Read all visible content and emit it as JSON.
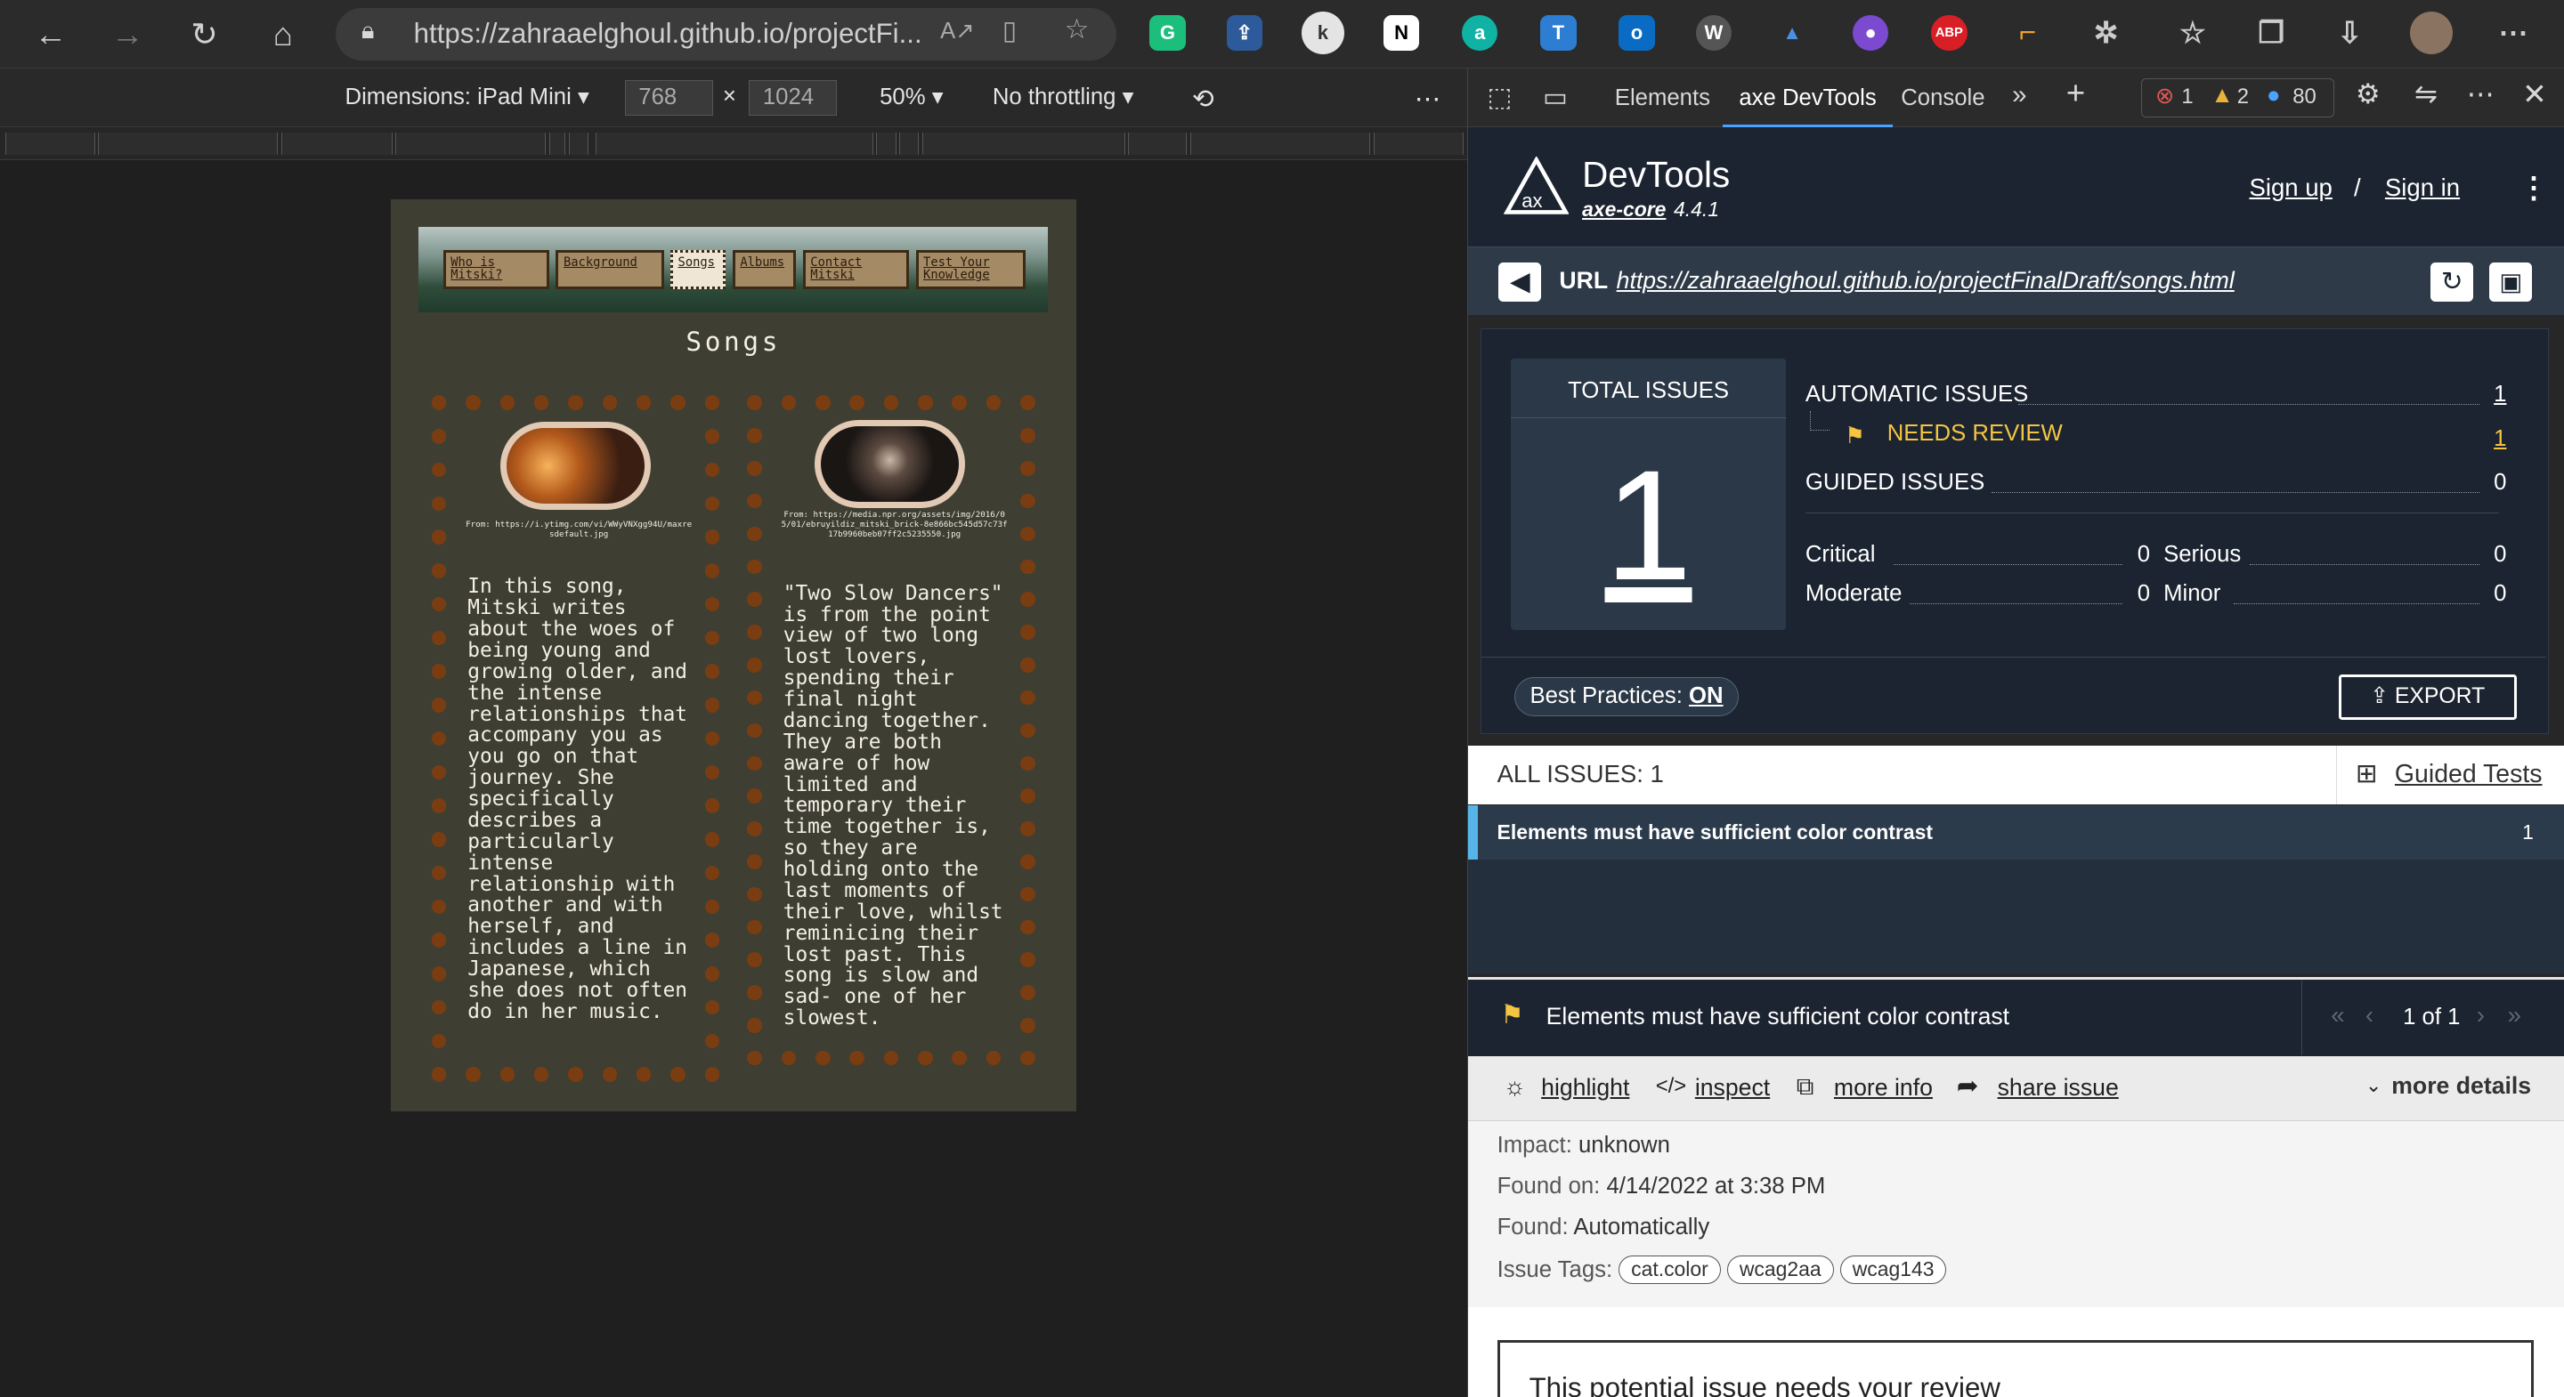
{
  "browser": {
    "url": "https://zahraaelghoul.github.io/projectFi...",
    "extensions": [
      "ABP"
    ]
  },
  "emulation": {
    "device": "Dimensions: iPad Mini",
    "width": "768",
    "times": "×",
    "height": "1024",
    "zoom": "50%",
    "throttle": "No throttling"
  },
  "site": {
    "nav": [
      "Who is Mitski?",
      "Background",
      "Songs",
      "Albums",
      "Contact Mitski",
      "Test Your Knowledge"
    ],
    "title": "Songs",
    "left_credit": "From: https://i.ytimg.com/vi/WWyVNXgg94U/maxresdefault.jpg",
    "left_text": "In this song, Mitski writes about the woes of being young and growing older, and the intense relationships that accompany you as you go on that journey. She specifically describes a particularly intense relationship with another and with herself, and includes a line in Japanese, which she does not often do in her music.",
    "right_credit": "From: https://media.npr.org/assets/img/2016/05/01/ebruyildiz_mitski_brick-8e866bc545d57c73f17b9960beb07ff2c5235550.jpg",
    "right_text": "\"Two Slow Dancers\" is from the point view of two long lost lovers, spending their final night dancing together. They are both aware of how limited and temporary their time together is, so they are holding onto the last moments of their love, whilst reminicing their lost past. This song is slow and sad- one of her slowest."
  },
  "devtools": {
    "tabs": [
      "Elements",
      "axe DevTools",
      "Console"
    ],
    "errors": "1",
    "warnings": "2",
    "info": "80"
  },
  "axe": {
    "brand": "DevTools",
    "core_link": "axe-core",
    "core_version": "4.4.1",
    "sign_up": "Sign up",
    "slash": "/",
    "sign_in": "Sign in",
    "url_label": "URL",
    "url": "https://zahraaelghoul.github.io/projectFinalDraft/songs.html",
    "total_label": "TOTAL ISSUES",
    "total": "1",
    "automatic_label": "AUTOMATIC ISSUES",
    "automatic": "1",
    "review_label": "NEEDS REVIEW",
    "review": "1",
    "guided_label": "GUIDED ISSUES",
    "guided": "0",
    "critical_label": "Critical",
    "critical": "0",
    "serious_label": "Serious",
    "serious": "0",
    "moderate_label": "Moderate",
    "moderate": "0",
    "minor_label": "Minor",
    "minor": "0",
    "best_practices": "Best Practices:",
    "best_practices_state": "ON",
    "export": "EXPORT",
    "all_issues": "ALL ISSUES: 1",
    "guided_tests": "Guided Tests",
    "issue_title": "Elements must have sufficient color contrast",
    "issue_count": "1",
    "detail_title": "Elements must have sufficient color contrast",
    "pager": "1 of 1",
    "actions": {
      "highlight": "highlight",
      "inspect": "inspect",
      "more_info": "more info",
      "share": "share issue",
      "more_details": "more details"
    },
    "impact_label": "Impact:",
    "impact": "unknown",
    "found_on_label": "Found on:",
    "found_on": "4/14/2022 at 3:38 PM",
    "found_label": "Found:",
    "found": "Automatically",
    "tags_label": "Issue Tags:",
    "tags": [
      "cat.color",
      "wcag2aa",
      "wcag143"
    ],
    "review_box": "This potential issue needs your review"
  }
}
